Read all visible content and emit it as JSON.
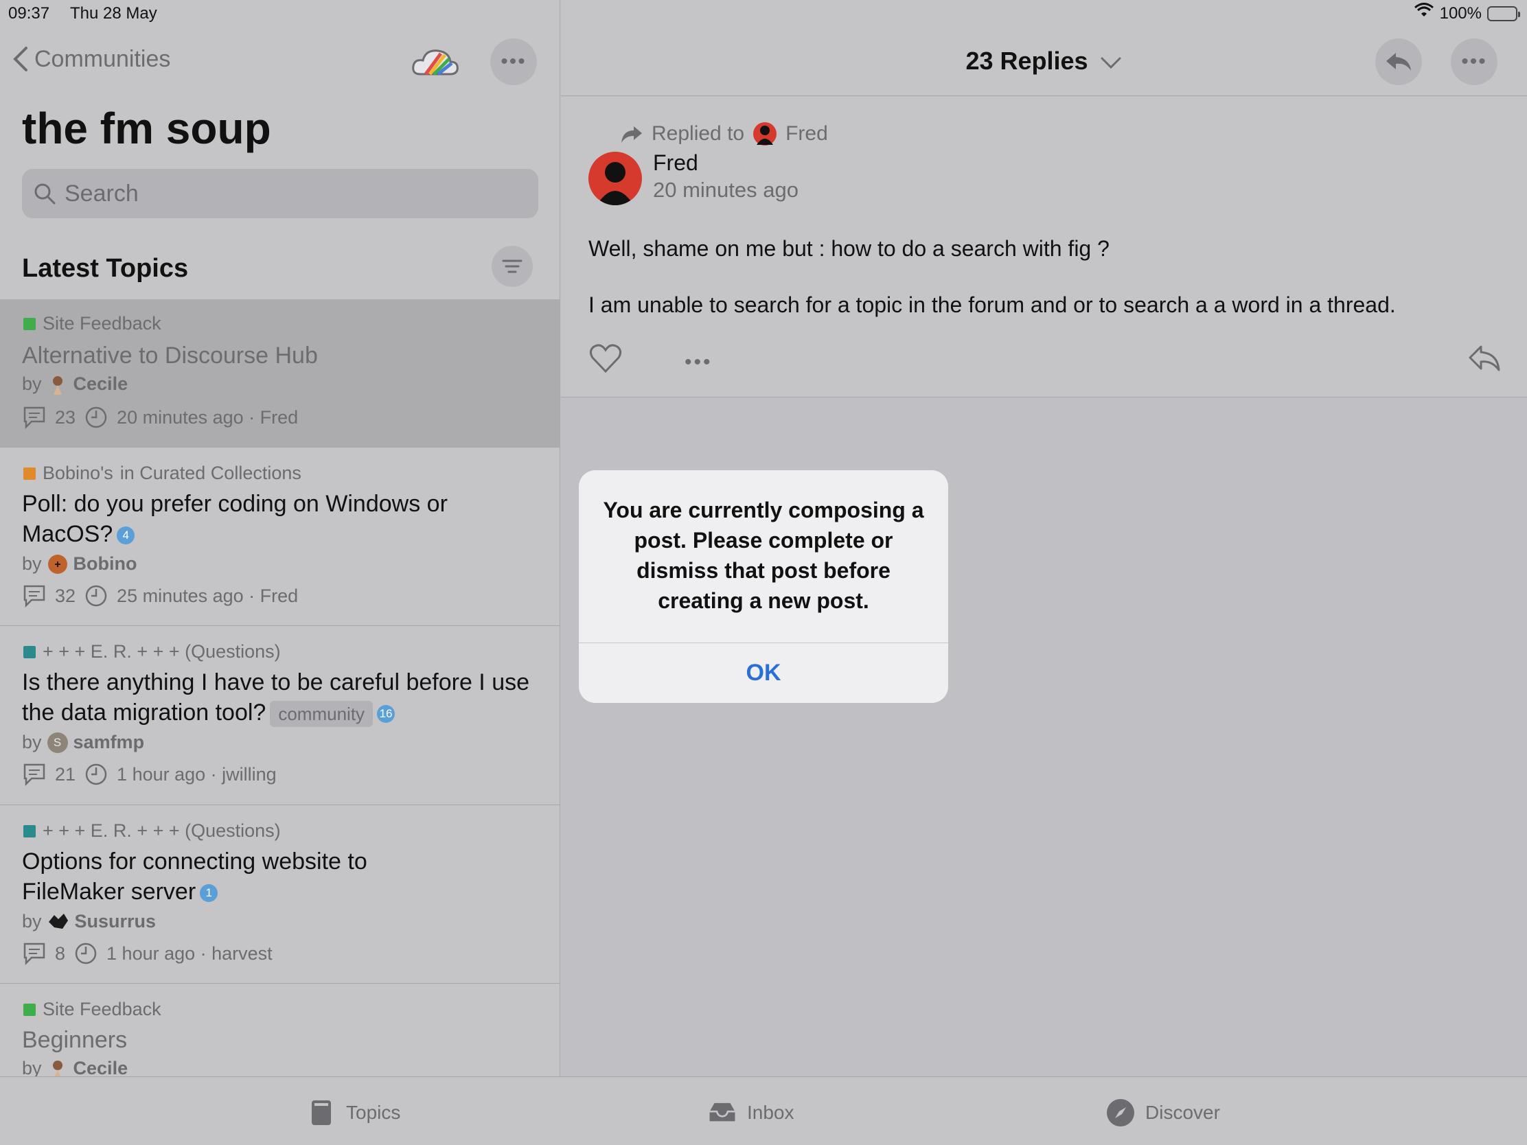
{
  "status": {
    "time": "09:37",
    "date": "Thu 28 May",
    "battery": "100%"
  },
  "left": {
    "back_label": "Communities",
    "title": "the fm soup",
    "search_placeholder": "Search",
    "section_title": "Latest Topics",
    "topics": [
      {
        "category": "Site Feedback",
        "category_color": "#3fae4a",
        "title": "Alternative to Discourse Hub",
        "by": "by",
        "author": "Cecile",
        "replies": "23",
        "activity": "20 minutes ago · Fred"
      },
      {
        "category": "Bobino's",
        "category_suffix": "in Curated Collections",
        "category_color": "#e08a2c",
        "title": "Poll: do you prefer coding on Windows or MacOS?",
        "badge": "4",
        "by": "by",
        "author": "Bobino",
        "replies": "32",
        "activity": "25 minutes ago · Fred"
      },
      {
        "category": "+ + + E. R. + + + (Questions)",
        "category_color": "#2b8a8c",
        "title": "Is there anything I have to be careful before I use the data migration tool?",
        "tag": "community",
        "badge": "16",
        "by": "by",
        "author": "samfmp",
        "author_initial": "S",
        "replies": "21",
        "activity": "1 hour ago · jwilling"
      },
      {
        "category": "+ + + E. R. + + + (Questions)",
        "category_color": "#2b8a8c",
        "title": "Options for connecting website to FileMaker server",
        "badge": "1",
        "by": "by",
        "author": "Susurrus",
        "replies": "8",
        "activity": "1 hour ago · harvest"
      },
      {
        "category": "Site Feedback",
        "category_color": "#3fae4a",
        "title": "Beginners",
        "by": "by",
        "author": "Cecile"
      }
    ]
  },
  "right": {
    "header_title": "23 Replies",
    "post": {
      "replied_to_label": "Replied to",
      "replied_to_user": "Fred",
      "author": "Fred",
      "time": "20 minutes ago",
      "body_line1": "Well, shame on me but : how to do a search with fig ?",
      "body_line2": "I am unable to search for a topic in the forum and or to search a a word in a thread."
    }
  },
  "dialog": {
    "message": "You are currently composing a post. Please complete or dismiss that post before creating a new post.",
    "ok_label": "OK"
  },
  "tabbar": {
    "topics": "Topics",
    "inbox": "Inbox",
    "discover": "Discover"
  },
  "colors": {
    "accent": "#2a6fd6",
    "badge": "#5a9fd8",
    "avatar_red": "#d63a2c"
  }
}
